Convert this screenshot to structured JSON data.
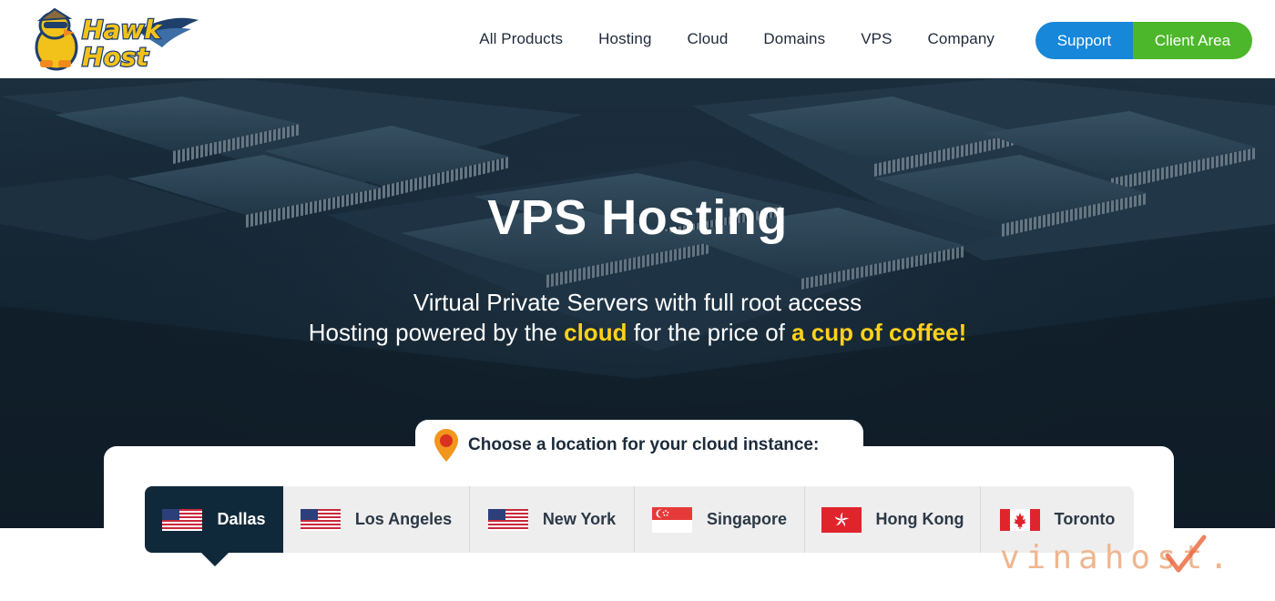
{
  "brand": {
    "logo_text_line1": "Hawk",
    "logo_text_line2": "Host"
  },
  "nav": {
    "items": [
      "All Products",
      "Hosting",
      "Cloud",
      "Domains",
      "VPS",
      "Company"
    ],
    "support_label": "Support",
    "client_area_label": "Client Area"
  },
  "hero": {
    "title": "VPS Hosting",
    "subtitle_line1": "Virtual Private Servers with full root access",
    "subtitle_pre": "Hosting powered by the ",
    "subtitle_hl1": "cloud",
    "subtitle_mid": " for the price of ",
    "subtitle_hl2": "a cup of coffee!"
  },
  "locations": {
    "heading": "Choose a location for your cloud instance:",
    "selected": "Dallas",
    "items": [
      {
        "name": "Dallas",
        "flag": "us-flag-icon"
      },
      {
        "name": "Los Angeles",
        "flag": "us-flag-icon"
      },
      {
        "name": "New York",
        "flag": "us-flag-icon"
      },
      {
        "name": "Singapore",
        "flag": "singapore-flag-icon"
      },
      {
        "name": "Hong Kong",
        "flag": "hong-kong-flag-icon"
      },
      {
        "name": "Toronto",
        "flag": "canada-flag-icon"
      }
    ]
  },
  "watermark": {
    "text": "vinahost."
  },
  "colors": {
    "support_blue": "#1687d9",
    "client_green": "#4cb72a",
    "highlight_yellow": "#ffd11a",
    "active_tab": "#10293a"
  }
}
